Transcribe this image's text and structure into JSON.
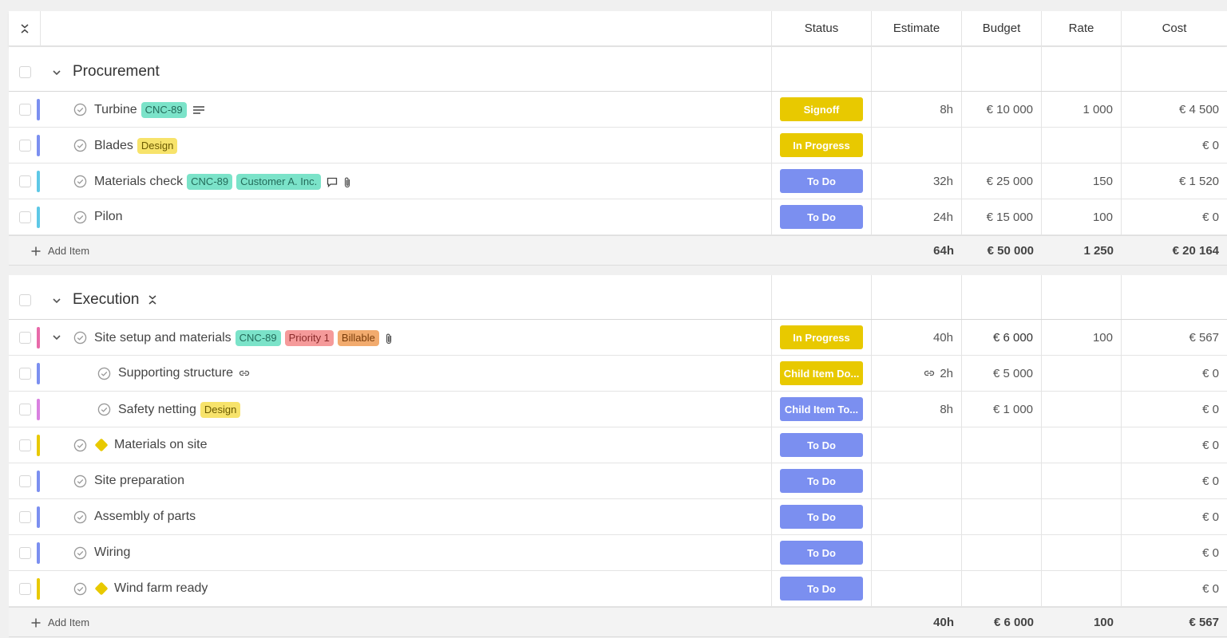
{
  "header": {
    "columns": {
      "status": "Status",
      "estimate": "Estimate",
      "budget": "Budget",
      "rate": "Rate",
      "cost": "Cost"
    }
  },
  "colors": {
    "status_yellow": "#e8c900",
    "status_blue": "#7b8ff0"
  },
  "groups": [
    {
      "title": "Procurement",
      "tasks": [
        {
          "name": "Turbine",
          "tags": [
            "CNC-89"
          ],
          "status": "Signoff",
          "estimate": "8h",
          "budget": "€ 10 000",
          "rate": "1 000",
          "cost": "€ 4 500"
        },
        {
          "name": "Blades",
          "tags": [
            "Design"
          ],
          "status": "In Progress",
          "estimate": "",
          "budget": "",
          "rate": "",
          "cost": "€ 0"
        },
        {
          "name": "Materials check",
          "tags": [
            "CNC-89",
            "Customer A. Inc."
          ],
          "status": "To Do",
          "estimate": "32h",
          "budget": "€ 25 000",
          "rate": "150",
          "cost": "€ 1 520"
        },
        {
          "name": "Pilon",
          "tags": [],
          "status": "To Do",
          "estimate": "24h",
          "budget": "€ 15 000",
          "rate": "100",
          "cost": "€ 0"
        }
      ],
      "footer": {
        "add_label": "Add Item",
        "estimate": "64h",
        "budget": "€ 50 000",
        "rate": "1 250",
        "cost": "€ 20 164"
      }
    },
    {
      "title": "Execution",
      "tasks": [
        {
          "name": "Site setup and materials",
          "tags": [
            "CNC-89",
            "Priority 1",
            "Billable"
          ],
          "status": "In Progress",
          "estimate": "40h",
          "budget": "€ 6 000",
          "rate": "100",
          "cost": "€ 567"
        },
        {
          "name": "Supporting structure",
          "tags": [],
          "status": "Child Item Do...",
          "estimate": "2h",
          "budget": "€ 5 000",
          "rate": "",
          "cost": "€ 0"
        },
        {
          "name": "Safety netting",
          "tags": [
            "Design"
          ],
          "status": "Child Item To...",
          "estimate": "8h",
          "budget": "€ 1 000",
          "rate": "",
          "cost": "€ 0"
        },
        {
          "name": "Materials on site",
          "tags": [],
          "status": "To Do",
          "estimate": "",
          "budget": "",
          "rate": "",
          "cost": "€ 0"
        },
        {
          "name": "Site preparation",
          "tags": [],
          "status": "To Do",
          "estimate": "",
          "budget": "",
          "rate": "",
          "cost": "€ 0"
        },
        {
          "name": "Assembly of parts",
          "tags": [],
          "status": "To Do",
          "estimate": "",
          "budget": "",
          "rate": "",
          "cost": "€ 0"
        },
        {
          "name": "Wiring",
          "tags": [],
          "status": "To Do",
          "estimate": "",
          "budget": "",
          "rate": "",
          "cost": "€ 0"
        },
        {
          "name": "Wind farm ready",
          "tags": [],
          "status": "To Do",
          "estimate": "",
          "budget": "",
          "rate": "",
          "cost": "€ 0"
        }
      ],
      "footer": {
        "add_label": "Add Item",
        "estimate": "40h",
        "budget": "€ 6 000",
        "rate": "100",
        "cost": "€ 567"
      }
    }
  ]
}
